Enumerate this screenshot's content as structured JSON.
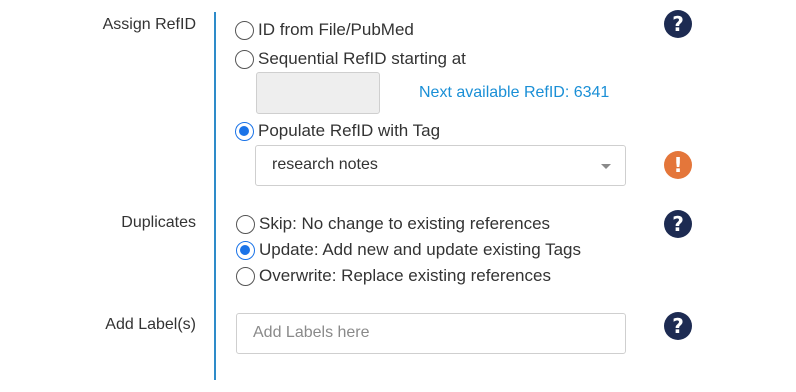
{
  "assign_refid": {
    "label": "Assign RefID",
    "options": [
      {
        "label": "ID from File/PubMed",
        "checked": false
      },
      {
        "label": "Sequential RefID starting at",
        "checked": false
      },
      {
        "label": "Populate RefID with Tag",
        "checked": true
      }
    ],
    "sequential_start_value": "",
    "next_available": "Next available RefID: 6341",
    "tag_select_value": "research notes",
    "help_icon": "question-mark-icon",
    "warning_icon": "exclamation-icon"
  },
  "duplicates": {
    "label": "Duplicates",
    "options": [
      {
        "label": "Skip: No change to existing references",
        "checked": false
      },
      {
        "label": "Update: Add new and update existing Tags",
        "checked": true
      },
      {
        "label": "Overwrite: Replace existing references",
        "checked": false
      }
    ],
    "help_icon": "question-mark-icon"
  },
  "add_labels": {
    "label": "Add Label(s)",
    "placeholder": "Add Labels here",
    "help_icon": "question-mark-icon"
  },
  "icons": {
    "help_glyph": "?",
    "warning_glyph": "!"
  },
  "colors": {
    "divider": "#2e8bc9",
    "link": "#1a8fd6",
    "radio_checked": "#1a73e8",
    "help_icon_bg": "#1d2b52",
    "warning_icon_bg": "#e4763a"
  }
}
